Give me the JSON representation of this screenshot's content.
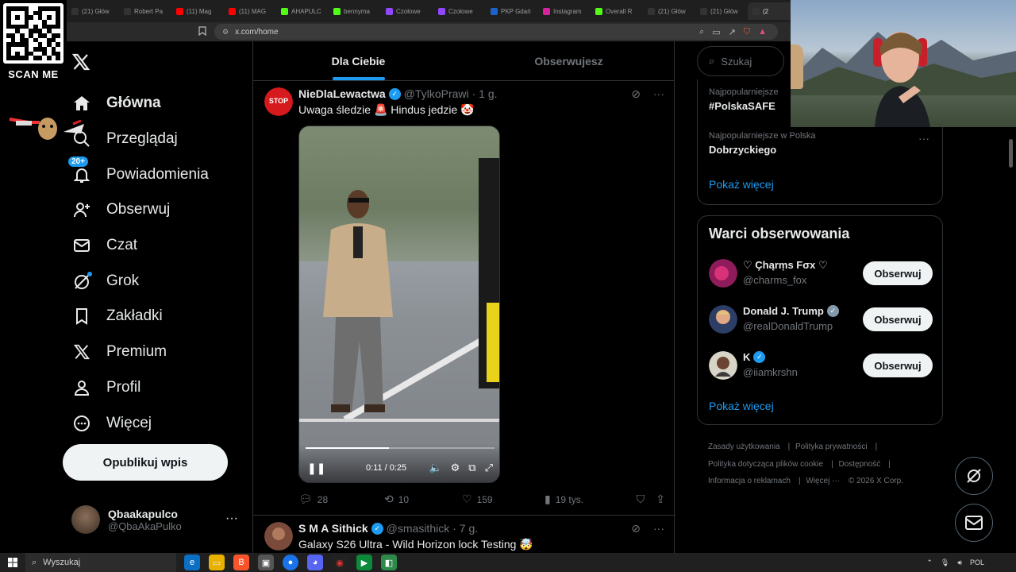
{
  "browser": {
    "tabs": [
      {
        "icon": "x-icon",
        "label": "(21) Głów",
        "color": "#000000"
      },
      {
        "icon": "tiktok-icon",
        "label": "Robert Pa",
        "color": "#000000"
      },
      {
        "icon": "youtube-icon",
        "label": "(11) Mag",
        "color": "#ff0000"
      },
      {
        "icon": "youtube-icon",
        "label": "(11) MAG",
        "color": "#ff0000"
      },
      {
        "icon": "kick-icon",
        "label": "AHAPULC",
        "color": "#53fc18"
      },
      {
        "icon": "kick-icon",
        "label": "bennyma",
        "color": "#53fc18"
      },
      {
        "icon": "twitch-icon",
        "label": "Czołowe",
        "color": "#9146ff"
      },
      {
        "icon": "twitch-icon",
        "label": "Czołowe",
        "color": "#9146ff"
      },
      {
        "icon": "pkp-icon",
        "label": "PKP Gdań",
        "color": "#1e62c9"
      },
      {
        "icon": "instagram-icon",
        "label": "Instagram",
        "color": "#d6249f"
      },
      {
        "icon": "kick-icon",
        "label": "Overall R",
        "color": "#53fc18"
      },
      {
        "icon": "x-icon",
        "label": "(21) Głów",
        "color": "#000000"
      },
      {
        "icon": "x-icon",
        "label": "(21) Głów",
        "color": "#000000"
      },
      {
        "icon": "x-icon",
        "label": "(2",
        "color": "#000000",
        "active": true
      }
    ],
    "url": "x.com/home"
  },
  "overlay": {
    "qr_label": "SCAN ME"
  },
  "sidebar": {
    "items": [
      {
        "name": "home",
        "icon": "home-icon",
        "label": "Główna",
        "active": true
      },
      {
        "name": "explore",
        "icon": "search-icon",
        "label": "Przeglądaj"
      },
      {
        "name": "notifications",
        "icon": "bell-icon",
        "label": "Powiadomienia",
        "badge": "20+"
      },
      {
        "name": "follow",
        "icon": "person-plus-icon",
        "label": "Obserwuj"
      },
      {
        "name": "chat",
        "icon": "mail-icon",
        "label": "Czat"
      },
      {
        "name": "grok",
        "icon": "grok-icon",
        "label": "Grok"
      },
      {
        "name": "bookmarks",
        "icon": "bookmark-icon",
        "label": "Zakładki"
      },
      {
        "name": "premium",
        "icon": "x-icon",
        "label": "Premium"
      },
      {
        "name": "profile",
        "icon": "person-icon",
        "label": "Profil"
      },
      {
        "name": "more",
        "icon": "more-circle-icon",
        "label": "Więcej"
      }
    ],
    "post_button": "Opublikuj wpis",
    "account": {
      "name": "Qbaakapulco",
      "handle": "@QbaAkaPulko"
    }
  },
  "feed": {
    "tabs": [
      {
        "label": "Dla Ciebie",
        "active": true
      },
      {
        "label": "Obserwujesz"
      }
    ],
    "tweets": [
      {
        "name": "NieDlaLewactwa",
        "handle": "@TylkoPrawi",
        "time": "· 1 g.",
        "text": "Uwaga śledzie 🚨 Hindus jedzie 🤡",
        "avatar_text": "STOP",
        "video": {
          "time": "0:11 / 0:25",
          "progress": 0.44
        },
        "stats": {
          "replies": "28",
          "reposts": "10",
          "likes": "159",
          "views": "19 tys."
        }
      },
      {
        "name": "S M A Sithick",
        "handle": "@smasithick",
        "time": "· 7 g.",
        "text": "Galaxy S26 Ultra - Wild Horizon lock Testing 🤯"
      }
    ]
  },
  "right": {
    "search_placeholder": "Szukaj",
    "trends": [
      {
        "sub": "Najpopularniejsze",
        "name": "#PolskaSAFE"
      },
      {
        "sub": "Najpopularniejsze w Polska",
        "name": "Dobrzyckiego"
      }
    ],
    "trends_more": "Pokaż więcej",
    "who_title": "Warci obserwowania",
    "who": [
      {
        "name": "♡ Çhąrṃs Fσx ♡",
        "handle": "@charms_fox",
        "verified": false,
        "button": "Obserwuj"
      },
      {
        "name": "Donald J. Trump",
        "handle": "@realDonaldTrump",
        "verified": true,
        "button": "Obserwuj"
      },
      {
        "name": "K",
        "handle": "@iiamkrshn",
        "verified": true,
        "button": "Obserwuj"
      }
    ],
    "who_more": "Pokaż więcej",
    "footer": {
      "terms": "Zasady użytkowania",
      "privacy": "Polityka prywatności",
      "cookies": "Polityka dotycząca plików cookie",
      "accessibility": "Dostępność",
      "ads": "Informacja o reklamach",
      "more": "Więcej ···",
      "copyright": "© 2026 X Corp."
    }
  },
  "taskbar": {
    "search": "Wyszukaj",
    "lang": "POL"
  },
  "colors": {
    "accent": "#1d9bf0",
    "background": "#000000",
    "border": "#2f3336",
    "muted": "#71767b"
  }
}
